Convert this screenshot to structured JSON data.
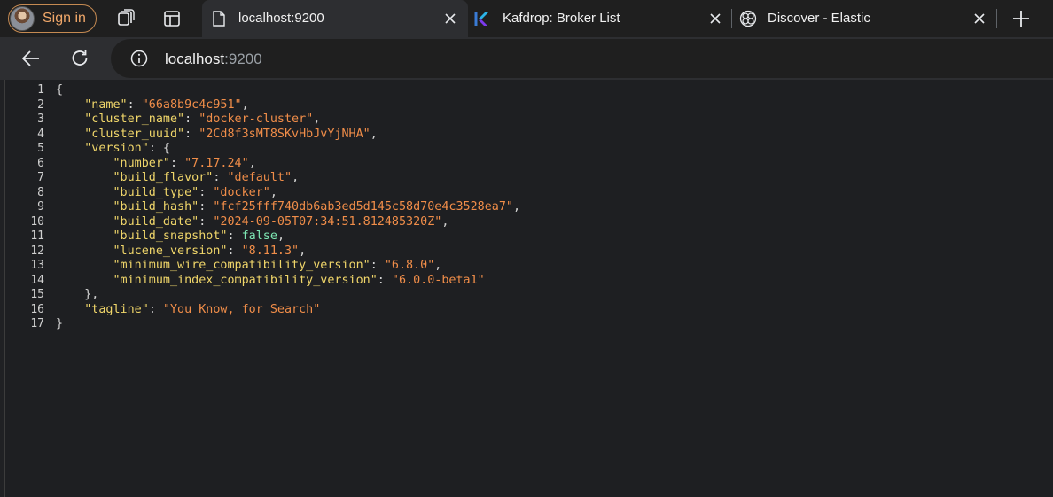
{
  "browser": {
    "signin_label": "Sign in",
    "tabs": [
      {
        "title": "localhost:9200",
        "icon": "document-icon",
        "active": true
      },
      {
        "title": "Kafdrop: Broker List",
        "icon": "kafdrop-logo-icon",
        "active": false
      },
      {
        "title": "Discover - Elastic",
        "icon": "elastic-globe-icon",
        "active": false
      }
    ],
    "address": {
      "host": "localhost",
      "port": ":9200"
    }
  },
  "viewer": {
    "lines": [
      [
        {
          "t": "p",
          "v": "{"
        }
      ],
      [
        {
          "t": "p",
          "v": "    "
        },
        {
          "t": "k",
          "v": "\"name\""
        },
        {
          "t": "p",
          "v": ": "
        },
        {
          "t": "s",
          "v": "\"66a8b9c4c951\""
        },
        {
          "t": "p",
          "v": ","
        }
      ],
      [
        {
          "t": "p",
          "v": "    "
        },
        {
          "t": "k",
          "v": "\"cluster_name\""
        },
        {
          "t": "p",
          "v": ": "
        },
        {
          "t": "s",
          "v": "\"docker-cluster\""
        },
        {
          "t": "p",
          "v": ","
        }
      ],
      [
        {
          "t": "p",
          "v": "    "
        },
        {
          "t": "k",
          "v": "\"cluster_uuid\""
        },
        {
          "t": "p",
          "v": ": "
        },
        {
          "t": "s",
          "v": "\"2Cd8f3sMT8SKvHbJvYjNHA\""
        },
        {
          "t": "p",
          "v": ","
        }
      ],
      [
        {
          "t": "p",
          "v": "    "
        },
        {
          "t": "k",
          "v": "\"version\""
        },
        {
          "t": "p",
          "v": ": {"
        }
      ],
      [
        {
          "t": "p",
          "v": "        "
        },
        {
          "t": "k",
          "v": "\"number\""
        },
        {
          "t": "p",
          "v": ": "
        },
        {
          "t": "s",
          "v": "\"7.17.24\""
        },
        {
          "t": "p",
          "v": ","
        }
      ],
      [
        {
          "t": "p",
          "v": "        "
        },
        {
          "t": "k",
          "v": "\"build_flavor\""
        },
        {
          "t": "p",
          "v": ": "
        },
        {
          "t": "s",
          "v": "\"default\""
        },
        {
          "t": "p",
          "v": ","
        }
      ],
      [
        {
          "t": "p",
          "v": "        "
        },
        {
          "t": "k",
          "v": "\"build_type\""
        },
        {
          "t": "p",
          "v": ": "
        },
        {
          "t": "s",
          "v": "\"docker\""
        },
        {
          "t": "p",
          "v": ","
        }
      ],
      [
        {
          "t": "p",
          "v": "        "
        },
        {
          "t": "k",
          "v": "\"build_hash\""
        },
        {
          "t": "p",
          "v": ": "
        },
        {
          "t": "s",
          "v": "\"fcf25fff740db6ab3ed5d145c58d70e4c3528ea7\""
        },
        {
          "t": "p",
          "v": ","
        }
      ],
      [
        {
          "t": "p",
          "v": "        "
        },
        {
          "t": "k",
          "v": "\"build_date\""
        },
        {
          "t": "p",
          "v": ": "
        },
        {
          "t": "s",
          "v": "\"2024-09-05T07:34:51.812485320Z\""
        },
        {
          "t": "p",
          "v": ","
        }
      ],
      [
        {
          "t": "p",
          "v": "        "
        },
        {
          "t": "k",
          "v": "\"build_snapshot\""
        },
        {
          "t": "p",
          "v": ": "
        },
        {
          "t": "b",
          "v": "false"
        },
        {
          "t": "p",
          "v": ","
        }
      ],
      [
        {
          "t": "p",
          "v": "        "
        },
        {
          "t": "k",
          "v": "\"lucene_version\""
        },
        {
          "t": "p",
          "v": ": "
        },
        {
          "t": "s",
          "v": "\"8.11.3\""
        },
        {
          "t": "p",
          "v": ","
        }
      ],
      [
        {
          "t": "p",
          "v": "        "
        },
        {
          "t": "k",
          "v": "\"minimum_wire_compatibility_version\""
        },
        {
          "t": "p",
          "v": ": "
        },
        {
          "t": "s",
          "v": "\"6.8.0\""
        },
        {
          "t": "p",
          "v": ","
        }
      ],
      [
        {
          "t": "p",
          "v": "        "
        },
        {
          "t": "k",
          "v": "\"minimum_index_compatibility_version\""
        },
        {
          "t": "p",
          "v": ": "
        },
        {
          "t": "s",
          "v": "\"6.0.0-beta1\""
        }
      ],
      [
        {
          "t": "p",
          "v": "    },"
        }
      ],
      [
        {
          "t": "p",
          "v": "    "
        },
        {
          "t": "k",
          "v": "\"tagline\""
        },
        {
          "t": "p",
          "v": ": "
        },
        {
          "t": "s",
          "v": "\"You Know, for Search\""
        }
      ],
      [
        {
          "t": "p",
          "v": "}"
        }
      ]
    ],
    "line_numbers": [
      "1",
      "2",
      "3",
      "4",
      "5",
      "6",
      "7",
      "8",
      "9",
      "10",
      "11",
      "12",
      "13",
      "14",
      "15",
      "16",
      "17"
    ]
  },
  "colors": {
    "key": "#f0d66a",
    "string": "#f08d49",
    "boolean": "#7ee8b4",
    "signin_accent": "#f1a86a"
  }
}
